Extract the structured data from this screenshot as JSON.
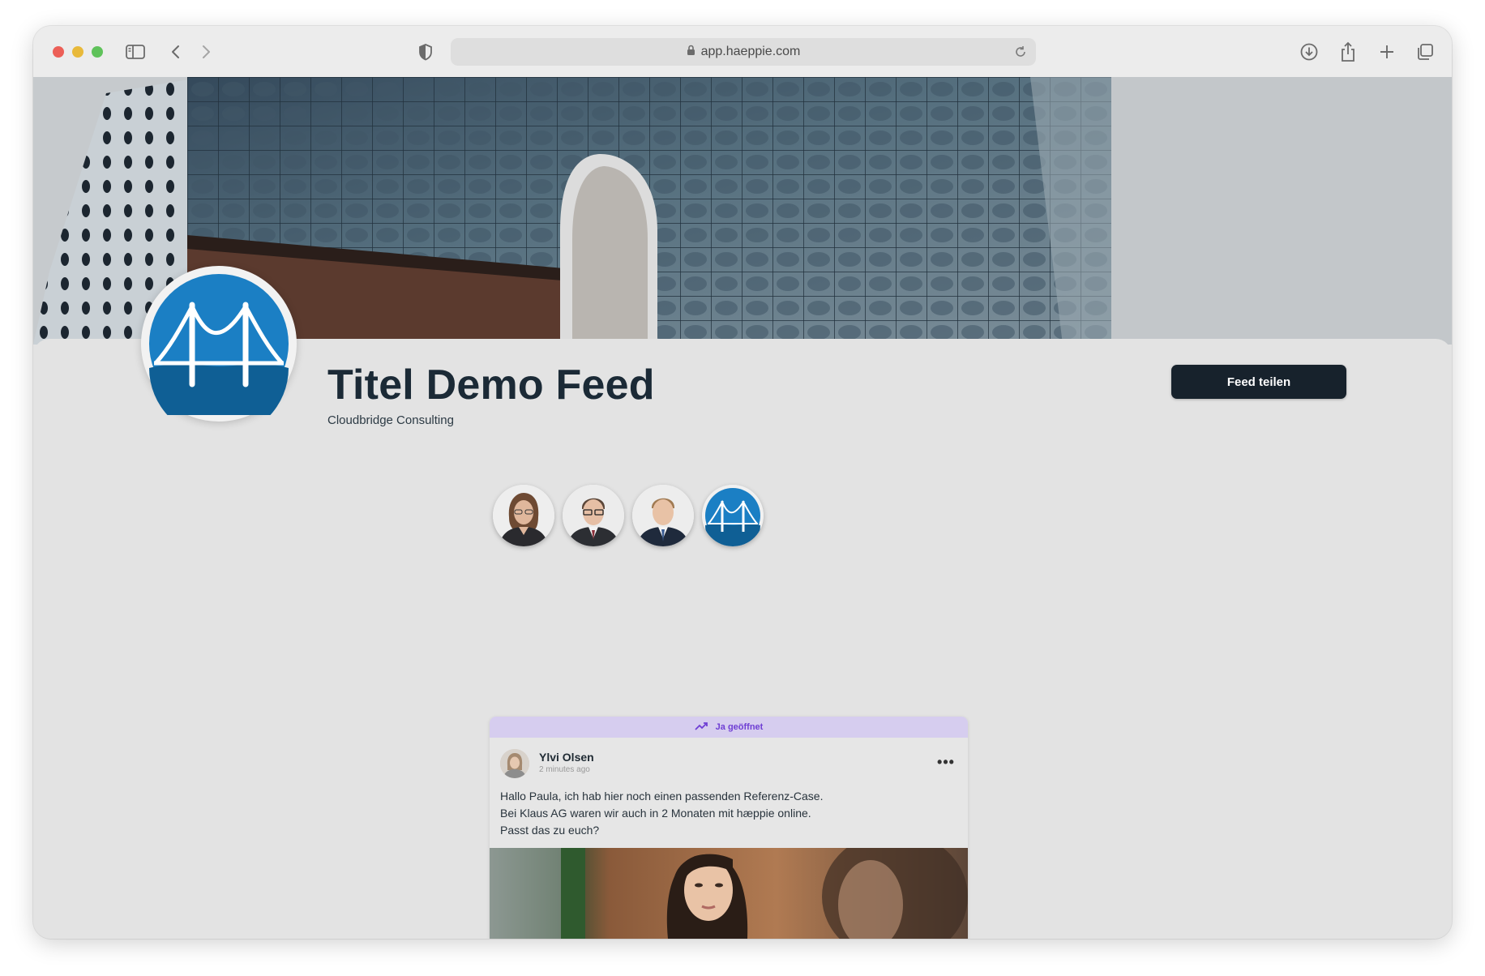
{
  "browser": {
    "url": "app.haeppie.com",
    "icons": {
      "sidebar": "sidebar-icon",
      "back": "chevron-left-icon",
      "forward": "chevron-right-icon",
      "privacy": "shield-icon",
      "lock": "lock-icon",
      "reload": "reload-icon",
      "download": "download-icon",
      "share": "share-icon",
      "new_tab": "plus-icon",
      "tabs": "tabs-overview-icon"
    }
  },
  "profile": {
    "title": "Titel Demo Feed",
    "company": "Cloudbridge Consulting",
    "share_button": "Feed teilen"
  },
  "members": [
    {
      "name": "member-woman-glasses"
    },
    {
      "name": "member-man-glasses"
    },
    {
      "name": "member-man-suit"
    },
    {
      "name": "member-company-logo"
    }
  ],
  "post": {
    "pinned_label": "Ja geöffnet",
    "author": "Ylvi Olsen",
    "time": "2 minutes ago",
    "menu": "•••",
    "text_lines": [
      "Hallo Paula, ich hab hier noch einen passenden Referenz-Case.",
      "Bei Klaus AG waren wir auch in 2 Monaten mit hæppie online.",
      "Passt das zu euch?"
    ]
  },
  "colors": {
    "logo_blue": "#1b7fc4",
    "logo_dark": "#0f5f95",
    "button_bg": "#17222c",
    "pinned_bg": "#d6cdef",
    "pinned_text": "#6f3fd4"
  }
}
